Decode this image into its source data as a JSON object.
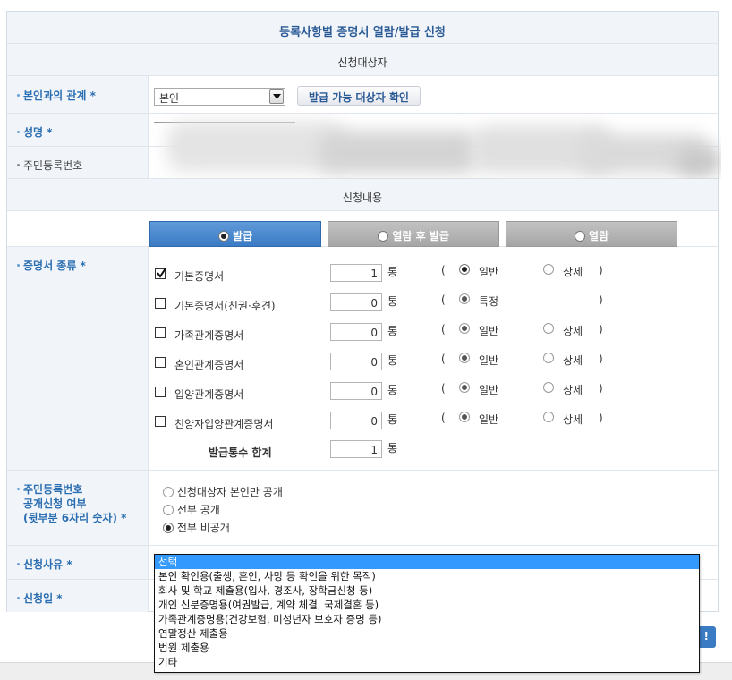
{
  "header": {
    "title": "등록사항별 증명서 열람/발급 신청"
  },
  "sections": {
    "applicant": "신청대상자",
    "content": "신청내용"
  },
  "relation": {
    "label": "본인과의 관계 *",
    "selected": "본인",
    "check_button": "발급 가능 대상자 확인"
  },
  "name": {
    "label": "성명 *"
  },
  "resident_no": {
    "label": "주민등록번호"
  },
  "tabs": [
    {
      "label": "발급",
      "active": true
    },
    {
      "label": "열람 후 발급",
      "active": false
    },
    {
      "label": "열람",
      "active": false
    }
  ],
  "certificates": {
    "label": "증명서 종류 *",
    "unit": "통",
    "paren_open": "(",
    "paren_close": ")",
    "items": [
      {
        "name": "기본증명서",
        "checked": true,
        "qty": "1",
        "opt1": "일반",
        "opt2": "상세"
      },
      {
        "name": "기본증명서(친권·후견)",
        "checked": false,
        "qty": "0",
        "opt1": "특정",
        "opt2": ""
      },
      {
        "name": "가족관계증명서",
        "checked": false,
        "qty": "0",
        "opt1": "일반",
        "opt2": "상세"
      },
      {
        "name": "혼인관계증명서",
        "checked": false,
        "qty": "0",
        "opt1": "일반",
        "opt2": "상세"
      },
      {
        "name": "입양관계증명서",
        "checked": false,
        "qty": "0",
        "opt1": "일반",
        "opt2": "상세"
      },
      {
        "name": "친양자입양관계증명서",
        "checked": false,
        "qty": "0",
        "opt1": "일반",
        "opt2": "상세"
      }
    ],
    "total_label": "발급통수 합계",
    "total_qty": "1"
  },
  "disclosure": {
    "label_line1": "주민등록번호",
    "label_line2": "공개신청 여부",
    "label_line3": "(뒷부분 6자리 숫자) *",
    "options": [
      {
        "label": "신청대상자 본인만 공개",
        "selected": false
      },
      {
        "label": "전부 공개",
        "selected": false
      },
      {
        "label": "전부 비공개",
        "selected": true
      }
    ]
  },
  "reason": {
    "label": "신청사유 *",
    "options": [
      "선택",
      "본인 확인용(출생, 혼인, 사망 등 확인을 위한 목적)",
      "회사 및 학교 제출용(입사, 경조사, 장학금신청 등)",
      "개인 신분증명용(여권발급, 계약 체결, 국제결혼 등)",
      "가족관계증명용(건강보험, 미성년자 보호자 증명 등)",
      "연말정산 제출용",
      "법원 제출용",
      "기타"
    ],
    "selected_index": 0
  },
  "date": {
    "label": "신청일 *"
  },
  "colors": {
    "label_blue": "#2a6db0",
    "tab_active": "#3b7bc4",
    "tab_inactive": "#a6a6a6",
    "highlight": "#3399ff"
  }
}
